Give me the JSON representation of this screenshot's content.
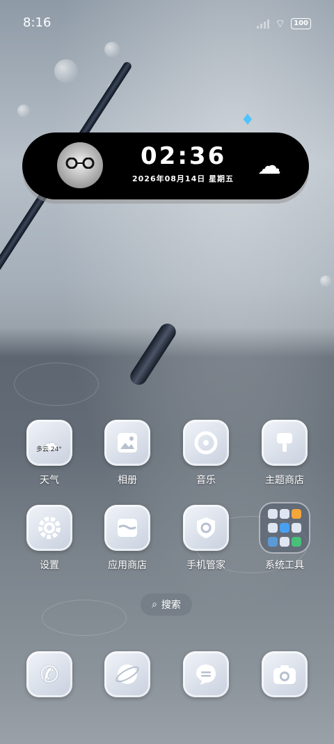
{
  "status_bar": {
    "time": "8:16",
    "battery": "100"
  },
  "widget": {
    "time": "02:36",
    "date": "2026年08月14日 星期五"
  },
  "apps": [
    {
      "label": "天气",
      "icon": "weather-icon",
      "extra": "多云 24°"
    },
    {
      "label": "相册",
      "icon": "gallery-icon"
    },
    {
      "label": "音乐",
      "icon": "music-icon"
    },
    {
      "label": "主题商店",
      "icon": "theme-store-icon"
    },
    {
      "label": "设置",
      "icon": "gear-icon"
    },
    {
      "label": "应用商店",
      "icon": "app-store-icon"
    },
    {
      "label": "手机管家",
      "icon": "security-shield-icon"
    },
    {
      "label": "系统工具",
      "icon": "folder-icon"
    }
  ],
  "search": {
    "label": "搜索"
  },
  "dock": [
    {
      "icon": "phone-icon"
    },
    {
      "icon": "browser-icon"
    },
    {
      "icon": "messages-icon"
    },
    {
      "icon": "camera-icon"
    }
  ]
}
